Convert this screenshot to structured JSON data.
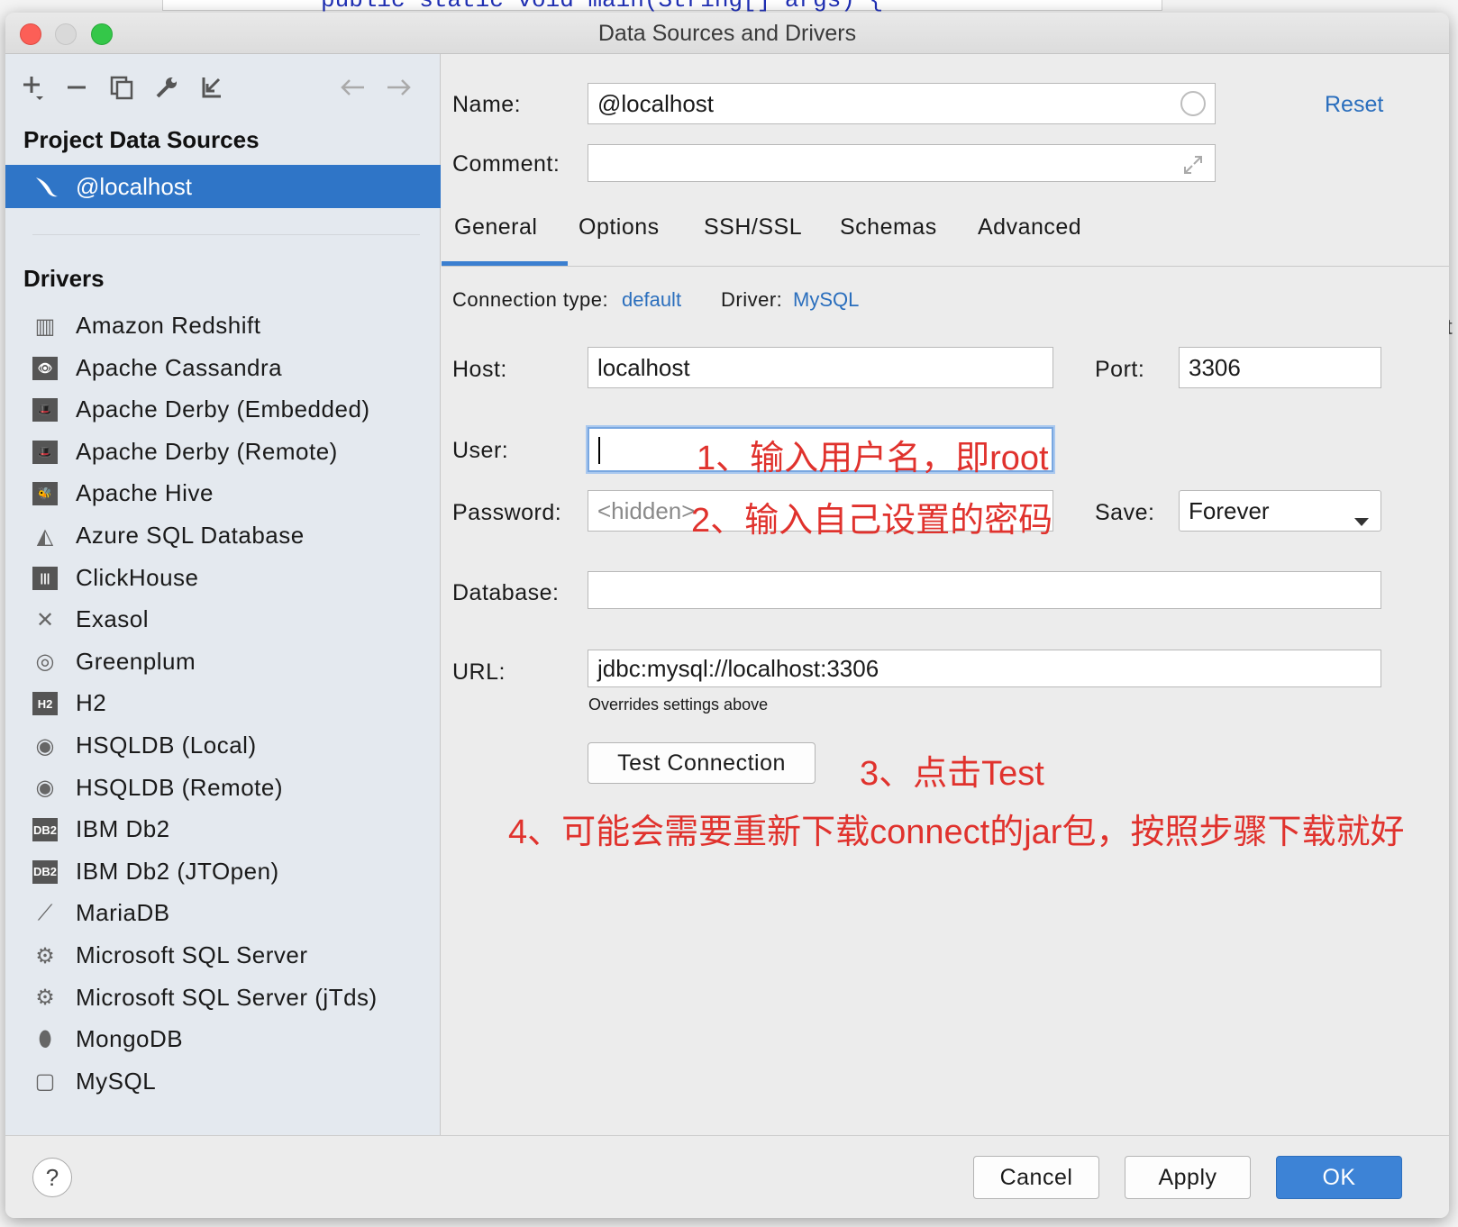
{
  "background": {
    "code_snippet": "public static void main(String[] args) {",
    "right_edge_char": "t"
  },
  "window": {
    "title": "Data Sources and Drivers"
  },
  "toolbar": {
    "add_icon": "plus-icon",
    "remove_icon": "minus-icon",
    "duplicate_icon": "copy-icon",
    "settings_icon": "wrench-icon",
    "import_icon": "import-icon",
    "back_icon": "arrow-left-icon",
    "forward_icon": "arrow-right-icon"
  },
  "sidebar": {
    "project_title": "Project Data Sources",
    "selected_source": "@localhost",
    "drivers_title": "Drivers",
    "drivers": [
      {
        "label": "Amazon Redshift",
        "icon": "redshift-icon",
        "glyph": "▥"
      },
      {
        "label": "Apache Cassandra",
        "icon": "cassandra-icon",
        "glyph": "👁"
      },
      {
        "label": "Apache Derby (Embedded)",
        "icon": "derby-icon",
        "glyph": "🎩"
      },
      {
        "label": "Apache Derby (Remote)",
        "icon": "derby-icon",
        "glyph": "🎩"
      },
      {
        "label": "Apache Hive",
        "icon": "hive-icon",
        "glyph": "🐝"
      },
      {
        "label": "Azure SQL Database",
        "icon": "azure-icon",
        "glyph": "◭"
      },
      {
        "label": "ClickHouse",
        "icon": "clickhouse-icon",
        "glyph": "|||"
      },
      {
        "label": "Exasol",
        "icon": "exasol-icon",
        "glyph": "✕"
      },
      {
        "label": "Greenplum",
        "icon": "greenplum-icon",
        "glyph": "◎"
      },
      {
        "label": "H2",
        "icon": "h2-icon",
        "glyph": "H2"
      },
      {
        "label": "HSQLDB (Local)",
        "icon": "hsqldb-icon",
        "glyph": "◉"
      },
      {
        "label": "HSQLDB (Remote)",
        "icon": "hsqldb-icon",
        "glyph": "◉"
      },
      {
        "label": "IBM Db2",
        "icon": "ibm-db2-icon",
        "glyph": "DB2"
      },
      {
        "label": "IBM Db2 (JTOpen)",
        "icon": "ibm-db2-icon",
        "glyph": "DB2"
      },
      {
        "label": "MariaDB",
        "icon": "mariadb-icon",
        "glyph": "⟋"
      },
      {
        "label": "Microsoft SQL Server",
        "icon": "sqlserver-icon",
        "glyph": "⚙"
      },
      {
        "label": "Microsoft SQL Server (jTds)",
        "icon": "sqlserver-icon",
        "glyph": "⚙"
      },
      {
        "label": "MongoDB",
        "icon": "mongodb-icon",
        "glyph": "⬮"
      },
      {
        "label": "MySQL",
        "icon": "mysql-icon",
        "glyph": "▢"
      }
    ]
  },
  "form": {
    "name_label": "Name:",
    "name_value": "@localhost",
    "reset_label": "Reset",
    "comment_label": "Comment:",
    "comment_value": "",
    "tabs": [
      "General",
      "Options",
      "SSH/SSL",
      "Schemas",
      "Advanced"
    ],
    "active_tab": "General",
    "connection_type_label": "Connection type:",
    "connection_type_value": "default",
    "driver_label": "Driver:",
    "driver_value": "MySQL",
    "host_label": "Host:",
    "host_value": "localhost",
    "port_label": "Port:",
    "port_value": "3306",
    "user_label": "User:",
    "user_value": "",
    "password_label": "Password:",
    "password_placeholder": "<hidden>",
    "save_label": "Save:",
    "save_value": "Forever",
    "database_label": "Database:",
    "database_value": "",
    "url_label": "URL:",
    "url_value": "jdbc:mysql://localhost:3306",
    "url_hint": "Overrides settings above",
    "test_connection_label": "Test Connection"
  },
  "annotations": {
    "step1": "1、输入用户名，即root",
    "step2": "2、输入自己设置的密码",
    "step3": "3、点击Test",
    "step4": "4、可能会需要重新下载connect的jar包，按照步骤下载就好",
    "color": "#e0322d"
  },
  "footer": {
    "help_label": "?",
    "cancel_label": "Cancel",
    "apply_label": "Apply",
    "ok_label": "OK"
  },
  "colors": {
    "selection": "#2f75c7",
    "link": "#2a6ebd",
    "primary_button": "#3d83d6"
  }
}
